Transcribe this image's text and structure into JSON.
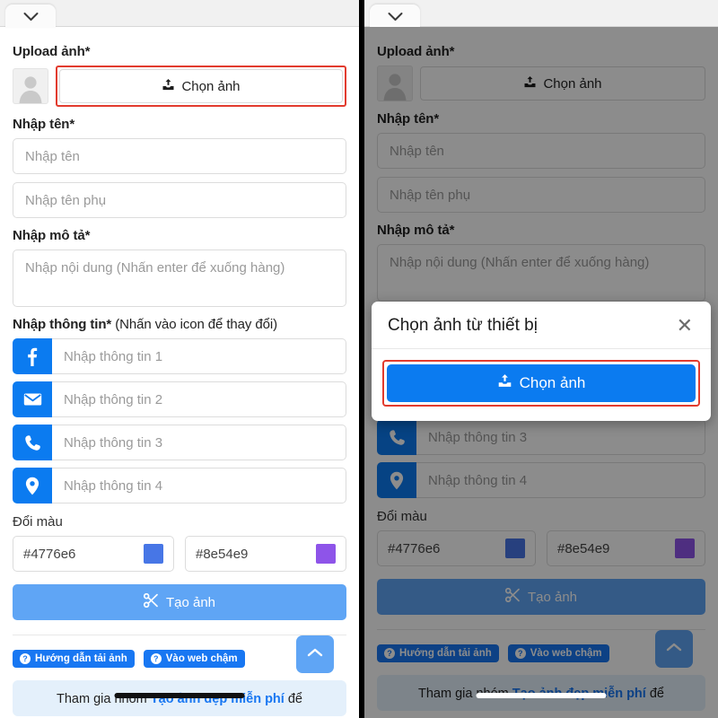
{
  "browser": {
    "tab_icon": "chevron-down-icon"
  },
  "form": {
    "upload_label": "Upload ảnh*",
    "choose_image_button": "Chọn ảnh",
    "avatar_icon": "user-placeholder-icon",
    "upload_icon": "upload-icon",
    "name_label": "Nhập tên*",
    "name_placeholder": "Nhập tên",
    "subname_placeholder": "Nhập tên phụ",
    "desc_label": "Nhập mô tả*",
    "desc_placeholder": "Nhập nội dung (Nhấn enter để xuống hàng)",
    "info_label_bold": "Nhập thông tin*",
    "info_label_rest": " (Nhấn vào icon để thay đổi)",
    "info_rows": [
      {
        "icon": "facebook-icon",
        "placeholder": "Nhập thông tin 1"
      },
      {
        "icon": "envelope-icon",
        "placeholder": "Nhập thông tin 2"
      },
      {
        "icon": "phone-icon",
        "placeholder": "Nhập thông tin 3"
      },
      {
        "icon": "location-pin-icon",
        "placeholder": "Nhập thông tin 4"
      }
    ],
    "color_label": "Đổi màu",
    "colors": [
      {
        "value": "#4776e6",
        "swatch": "#4776e6"
      },
      {
        "value": "#8e54e9",
        "swatch": "#8e54e9"
      }
    ],
    "generate_button": "Tạo ảnh",
    "generate_icon": "scissors-icon",
    "generate_color": "#5fa5f5"
  },
  "footer": {
    "badges": [
      {
        "icon": "question-circle-icon",
        "label": "Hướng dẫn tải ảnh"
      },
      {
        "icon": "question-circle-icon",
        "label": "Vào web chậm"
      }
    ],
    "scroll_top_icon": "chevron-up-icon",
    "note_prefix": "Tham gia nhóm ",
    "note_link": "Tạo ảnh đẹp miễn phí",
    "note_suffix": " để"
  },
  "modal": {
    "title": "Chọn ảnh từ thiết bị",
    "close_icon": "close-icon",
    "button_label": "Chọn ảnh",
    "button_icon": "upload-icon",
    "button_color": "#0b7bf0",
    "highlight_color": "#e23b2e"
  }
}
